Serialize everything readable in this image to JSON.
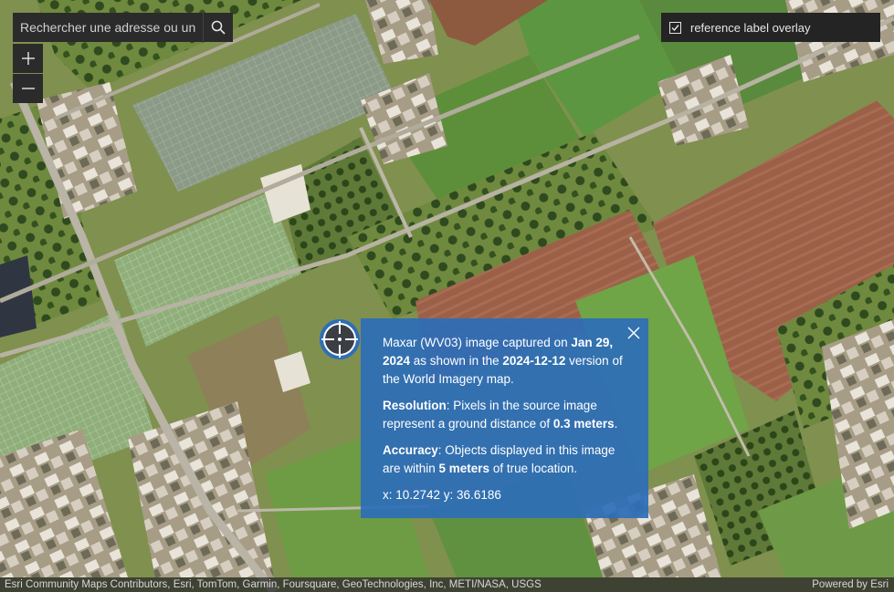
{
  "search": {
    "placeholder": "Rechercher une adresse ou un lieu"
  },
  "zoom": {
    "in_label": "+",
    "out_label": "—"
  },
  "overlay_toggle": {
    "label": "reference label overlay",
    "checked": true
  },
  "popup": {
    "intro_prefix": "Maxar (WV03) image captured on ",
    "capture_date": "Jan 29, 2024",
    "intro_mid": " as shown in the ",
    "version": "2024-12-12",
    "intro_suffix": " version of the World Imagery map.",
    "resolution_label": "Resolution",
    "resolution_text": ": Pixels in the source image represent a ground distance of ",
    "resolution_value": "0.3 meters",
    "resolution_end": ".",
    "accuracy_label": "Accuracy",
    "accuracy_text": ": Objects displayed in this image are within ",
    "accuracy_value": "5 meters",
    "accuracy_end": " of true location.",
    "coords": "x: 10.2742 y: 36.6186"
  },
  "attribution": {
    "sources": "Esri Community Maps Contributors, Esri, TomTom, Garmin, Foursquare, GeoTechnologies, Inc, METI/NASA, USGS",
    "powered_by": "Powered by Esri"
  },
  "colors": {
    "popup_bg": "#2d6eb9",
    "control_bg": "#2b2b2b"
  },
  "icons": [
    "search-icon",
    "plus-icon",
    "minus-icon",
    "checkbox-check-icon",
    "crosshair-marker-icon",
    "close-icon"
  ]
}
